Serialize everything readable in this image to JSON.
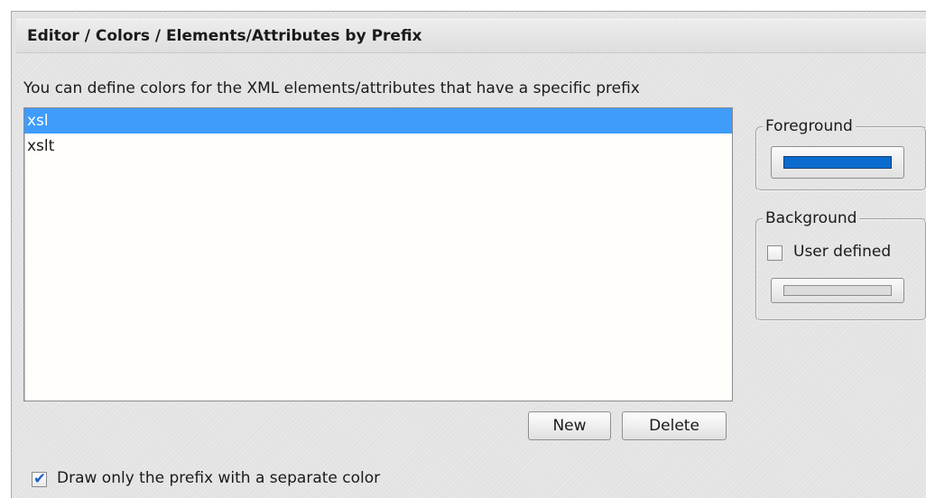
{
  "header": {
    "title": "Editor / Colors / Elements/Attributes by Prefix"
  },
  "description": "You can define colors for the XML elements/attributes that have a specific prefix",
  "prefix_list": {
    "items": [
      {
        "label": "xsl",
        "selected": true
      },
      {
        "label": "xslt",
        "selected": false
      }
    ]
  },
  "buttons": {
    "new_label": "New",
    "delete_label": "Delete"
  },
  "foreground": {
    "legend": "Foreground",
    "color": "#0a6cd0"
  },
  "background": {
    "legend": "Background",
    "user_defined_label": "User defined",
    "user_defined_checked": false,
    "color": "#dcdcdc"
  },
  "draw_prefix": {
    "label": "Draw only the prefix with a separate color",
    "checked": true
  },
  "colors": {
    "selection": "#3f9cfb",
    "panel": "#e4e4e4",
    "list_background": "#fffefb"
  }
}
